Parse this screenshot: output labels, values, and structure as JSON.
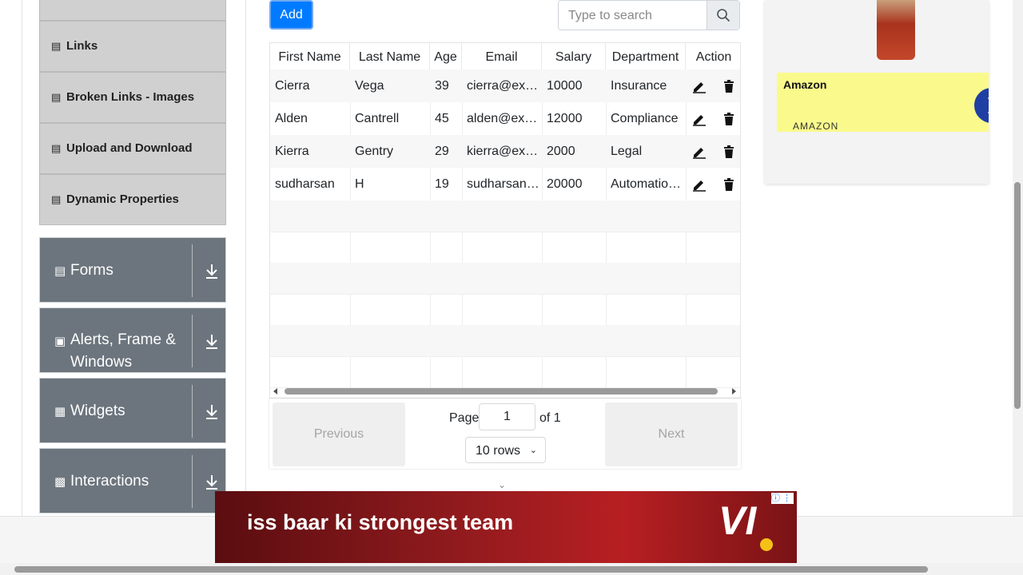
{
  "sidebar": {
    "items": [
      {
        "label": "Links"
      },
      {
        "label": "Broken Links - Images"
      },
      {
        "label": "Upload and Download"
      },
      {
        "label": "Dynamic Properties"
      }
    ],
    "groups": [
      {
        "label": "Forms",
        "icon": "document-icon"
      },
      {
        "label": "Alerts, Frame & Windows",
        "icon": "window-icon"
      },
      {
        "label": "Widgets",
        "icon": "widgets-icon"
      },
      {
        "label": "Interactions",
        "icon": "interactions-icon"
      }
    ]
  },
  "toolbar": {
    "add_label": "Add",
    "search_placeholder": "Type to search"
  },
  "table": {
    "headers": [
      "First Name",
      "Last Name",
      "Age",
      "Email",
      "Salary",
      "Department",
      "Action"
    ],
    "rows": [
      {
        "first": "Cierra",
        "last": "Vega",
        "age": "39",
        "email": "cierra@ex…",
        "salary": "10000",
        "dept": "Insurance"
      },
      {
        "first": "Alden",
        "last": "Cantrell",
        "age": "45",
        "email": "alden@ex…",
        "salary": "12000",
        "dept": "Compliance"
      },
      {
        "first": "Kierra",
        "last": "Gentry",
        "age": "29",
        "email": "kierra@ex…",
        "salary": "2000",
        "dept": "Legal"
      },
      {
        "first": "sudharsan",
        "last": "H",
        "age": "19",
        "email": "sudharsan…",
        "salary": "20000",
        "dept": "Automatio…"
      }
    ]
  },
  "pagination": {
    "previous": "Previous",
    "next": "Next",
    "page_label": "Page",
    "page_value": "1",
    "of_label": "of 1",
    "rows_label": "10 rows"
  },
  "ads": {
    "right_title": "Amazon",
    "right_brand": "AMAZON",
    "bottom_text": "iss baar ki strongest team",
    "bottom_logo": "VI"
  },
  "colors": {
    "primary": "#007bff",
    "sidebar_group": "#6c757d",
    "sidebar_item": "#d0d0d0"
  }
}
